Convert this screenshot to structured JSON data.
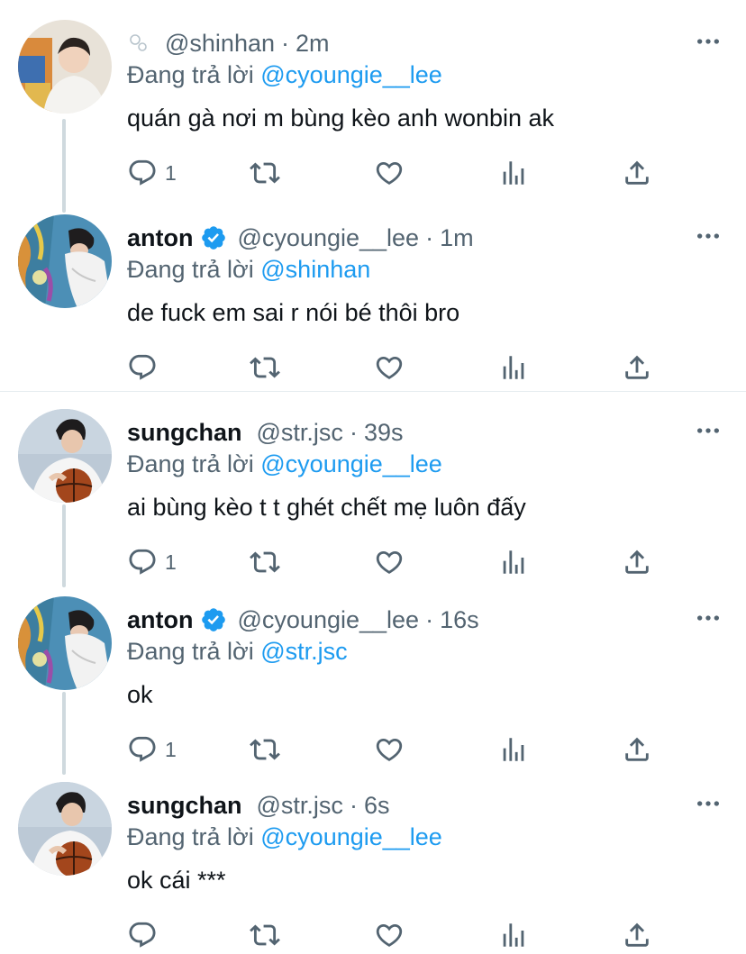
{
  "tweets": [
    {
      "name": "",
      "handle": "@shinhan",
      "dot": "·",
      "time": "2m",
      "reply_prefix": "Đang trả lời ",
      "reply_to": "@cyoungie__lee",
      "text": "quán gà nơi m bùng kèo anh wonbin ak",
      "reply_count": "1",
      "verified": false,
      "avatar": "avatar-shinhan"
    },
    {
      "name": "anton",
      "handle": "@cyoungie__lee",
      "dot": "·",
      "time": "1m",
      "reply_prefix": "Đang trả lời ",
      "reply_to": "@shinhan",
      "text": "de fuck em sai r nói bé thôi bro",
      "reply_count": "",
      "verified": true,
      "avatar": "avatar-anton"
    },
    {
      "name": "sungchan",
      "handle": "@str.jsc",
      "dot": "·",
      "time": "39s",
      "reply_prefix": "Đang trả lời ",
      "reply_to": "@cyoungie__lee",
      "text": "ai bùng kèo t t ghét chết mẹ luôn đấy",
      "reply_count": "1",
      "verified": false,
      "avatar": "avatar-sungchan"
    },
    {
      "name": "anton",
      "handle": "@cyoungie__lee",
      "dot": "·",
      "time": "16s",
      "reply_prefix": "Đang trả lời ",
      "reply_to": "@str.jsc",
      "text": "ok",
      "reply_count": "1",
      "verified": true,
      "avatar": "avatar-anton"
    },
    {
      "name": "sungchan",
      "handle": "@str.jsc",
      "dot": "·",
      "time": "6s",
      "reply_prefix": "Đang trả lời ",
      "reply_to": "@cyoungie__lee",
      "text": "ok cái ***",
      "reply_count": "",
      "verified": false,
      "avatar": "avatar-sungchan"
    }
  ],
  "icons": {
    "reply": "reply-icon",
    "retweet": "retweet-icon",
    "like": "like-icon",
    "analytics": "analytics-icon",
    "share": "share-icon",
    "more": "more-options-icon",
    "verified": "verified-badge-icon"
  },
  "colors": {
    "link": "#1d9bf0",
    "secondary": "#536471",
    "verified": "#1d9bf0",
    "thread_line": "#cfd9de"
  }
}
